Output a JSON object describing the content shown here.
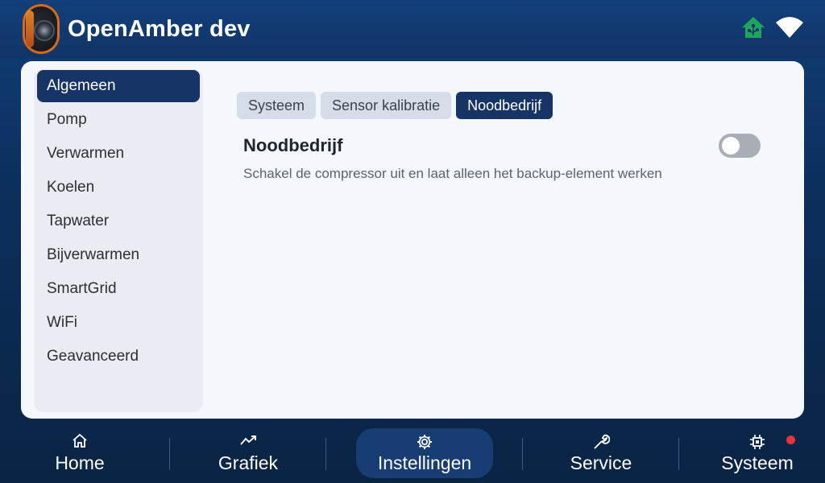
{
  "header": {
    "title": "OpenAmber dev",
    "logo_icon": "heat-pump-logo",
    "status_icons": [
      "home-network-icon",
      "wifi-icon"
    ],
    "accent": "#1ea55a"
  },
  "sidebar": {
    "items": [
      {
        "label": "Algemeen",
        "active": true
      },
      {
        "label": "Pomp"
      },
      {
        "label": "Verwarmen"
      },
      {
        "label": "Koelen"
      },
      {
        "label": "Tapwater"
      },
      {
        "label": "Bijverwarmen"
      },
      {
        "label": "SmartGrid"
      },
      {
        "label": "WiFi"
      },
      {
        "label": "Geavanceerd"
      }
    ]
  },
  "tabs": [
    {
      "label": "Systeem"
    },
    {
      "label": "Sensor kalibratie"
    },
    {
      "label": "Noodbedrijf",
      "active": true
    }
  ],
  "setting": {
    "title": "Noodbedrijf",
    "description": "Schakel de compressor uit en laat alleen het backup-element werken",
    "enabled": false
  },
  "bottom_nav": {
    "items": [
      {
        "label": "Home",
        "icon": "home-icon"
      },
      {
        "label": "Grafiek",
        "icon": "chart-icon"
      },
      {
        "label": "Instellingen",
        "icon": "gear-icon",
        "active": true
      },
      {
        "label": "Service",
        "icon": "wrench-icon"
      },
      {
        "label": "Systeem",
        "icon": "chip-icon",
        "alert": true
      }
    ]
  },
  "colors": {
    "primary": "#173466",
    "background": "#0f3568",
    "panel": "#f4f8fc",
    "alert": "#e8343a"
  }
}
